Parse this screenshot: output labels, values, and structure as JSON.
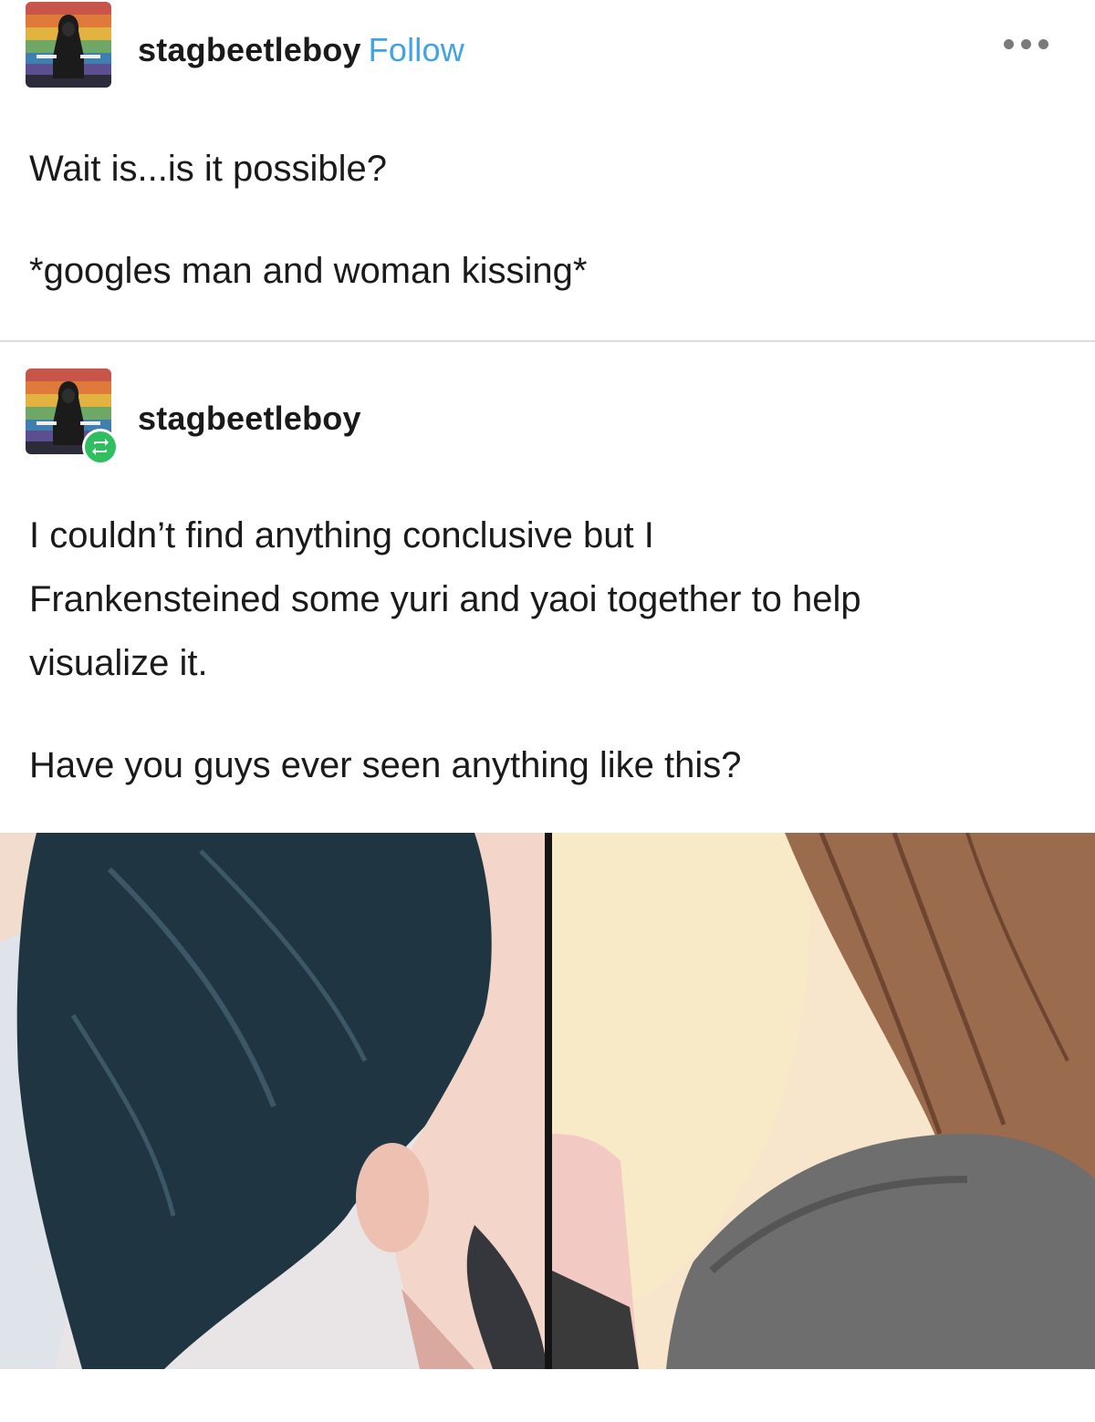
{
  "post": {
    "author": "stagbeetleboy",
    "follow_label": "Follow",
    "more_icon": "more-dots-icon",
    "lines": [
      "Wait is...is it possible?",
      "*googles man and woman kissing*"
    ]
  },
  "reblog": {
    "author": "stagbeetleboy",
    "badge_icon": "reblog-icon",
    "paragraph1": [
      "I couldn’t find anything conclusive but I",
      "Frankensteined some yuri and yaoi together to help",
      "visualize it."
    ],
    "paragraph2": "Have you guys ever seen anything like this?"
  },
  "image": {
    "description_icon": "kissing-collage-image"
  },
  "colors": {
    "follow": "#3fa3e6",
    "reblog_badge": "#2fbf5f",
    "text": "#1a1a1a",
    "divider": "#dddddd"
  }
}
